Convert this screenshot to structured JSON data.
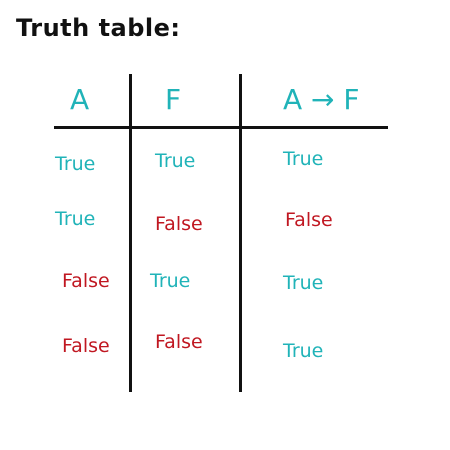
{
  "title": "Truth table:",
  "colors": {
    "true": "#20b3b8",
    "false": "#c01721",
    "ink": "#111111"
  },
  "headers": [
    "A",
    "F",
    "A → F"
  ],
  "rows": [
    [
      "True",
      "True",
      "True"
    ],
    [
      "True",
      "False",
      "False"
    ],
    [
      "False",
      "True",
      "True"
    ],
    [
      "False",
      "False",
      "True"
    ]
  ]
}
